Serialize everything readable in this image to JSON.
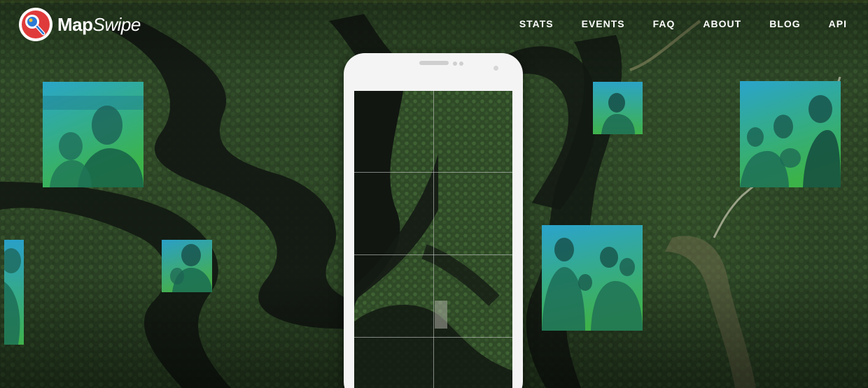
{
  "brand": {
    "name_bold": "Map",
    "name_italic": "Swipe"
  },
  "nav": {
    "items": [
      {
        "label": "STATS"
      },
      {
        "label": "EVENTS"
      },
      {
        "label": "FAQ"
      },
      {
        "label": "ABOUT"
      },
      {
        "label": "BLOG"
      },
      {
        "label": "API"
      }
    ]
  },
  "colors": {
    "photo_tint_top": "#2aa0c8",
    "photo_tint_bottom": "#37b34a",
    "forest": "#2f4a27",
    "river": "#141a14",
    "phone_body": "#f4f4f4",
    "top_accent": "#6f8a2e"
  },
  "icons": {
    "logo": "mapswipe-magnifier-logo"
  }
}
